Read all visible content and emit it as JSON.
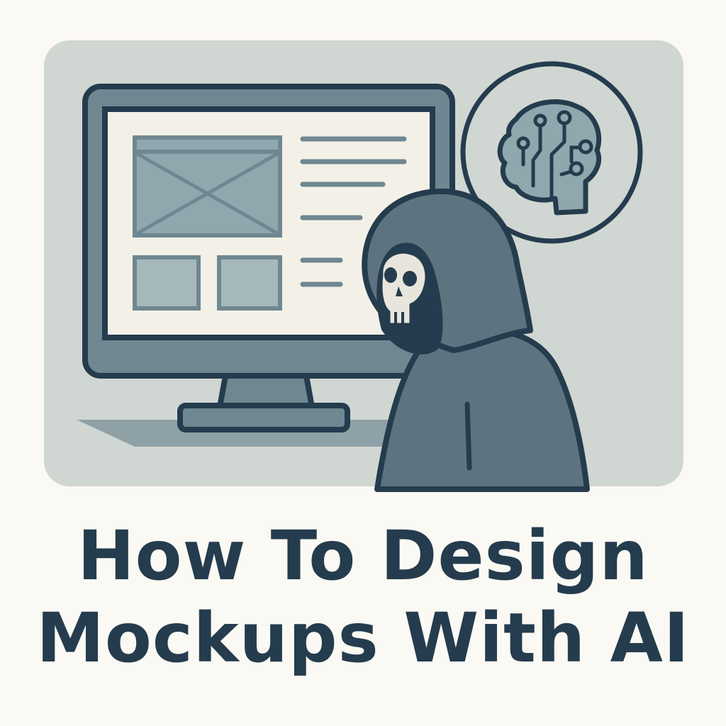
{
  "title": {
    "line1": "How To Design",
    "line2": "Mockups With AI"
  },
  "illustration": {
    "icons": [
      "monitor-icon",
      "wireframe-icon",
      "brain-circuit-icon",
      "hooded-skull-figure-icon"
    ],
    "colors": {
      "background": "#fbf9f3",
      "panel": "#d0d6d1",
      "outline": "#253c4e",
      "monitor_frame": "#6f8791",
      "screen": "#f3f1e7",
      "accent": "#8fa8ae",
      "hood": "#5e7380"
    }
  }
}
